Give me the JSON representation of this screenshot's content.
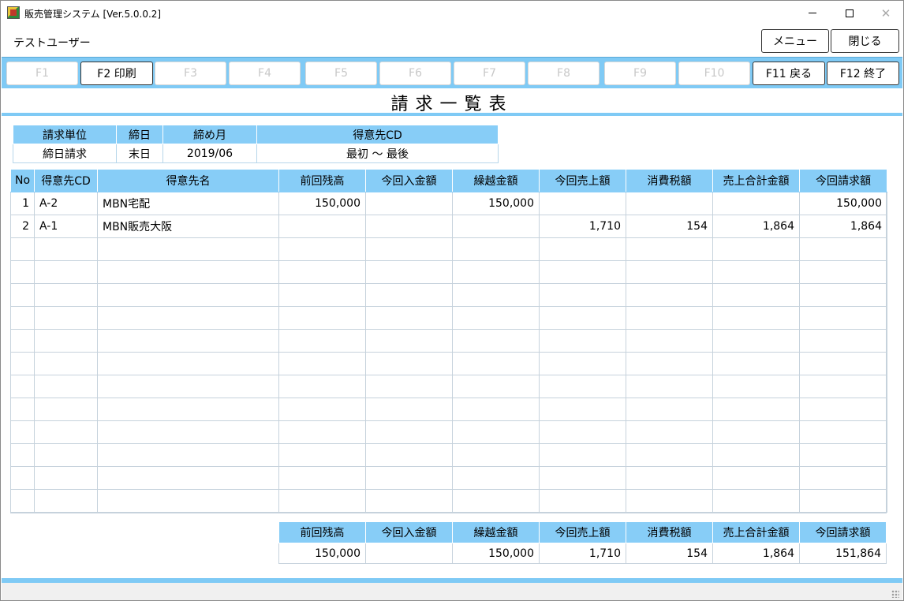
{
  "window": {
    "title": "販売管理システム [Ver.5.0.0.2]",
    "minimize": "",
    "maximize": "",
    "close": "✕"
  },
  "user": {
    "name": "テストユーザー"
  },
  "top_buttons": {
    "menu": "メニュー",
    "close": "閉じる"
  },
  "fkeys": [
    {
      "label": "F1",
      "enabled": false
    },
    {
      "label": "F2 印刷",
      "enabled": true
    },
    {
      "label": "F3",
      "enabled": false
    },
    {
      "label": "F4",
      "enabled": false
    },
    {
      "label": "F5",
      "enabled": false
    },
    {
      "label": "F6",
      "enabled": false
    },
    {
      "label": "F7",
      "enabled": false
    },
    {
      "label": "F8",
      "enabled": false
    },
    {
      "label": "F9",
      "enabled": false
    },
    {
      "label": "F10",
      "enabled": false
    },
    {
      "label": "F11 戻る",
      "enabled": true
    },
    {
      "label": "F12 終了",
      "enabled": true
    }
  ],
  "page": {
    "title": "請求一覧表"
  },
  "conditions": {
    "headers": [
      "請求単位",
      "締日",
      "締め月",
      "得意先CD"
    ],
    "values": [
      "締日請求",
      "末日",
      "2019/06",
      "最初 ～ 最後"
    ]
  },
  "main_table": {
    "headers": [
      "No",
      "得意先CD",
      "得意先名",
      "前回残高",
      "今回入金額",
      "繰越金額",
      "今回売上額",
      "消費税額",
      "売上合計金額",
      "今回請求額"
    ],
    "rows": [
      [
        "1",
        "A-2",
        "MBN宅配",
        "150,000",
        "",
        "150,000",
        "",
        "",
        "",
        "150,000"
      ],
      [
        "2",
        "A-1",
        "MBN販売大阪",
        "",
        "",
        "",
        "1,710",
        "154",
        "1,864",
        "1,864"
      ]
    ]
  },
  "totals": {
    "headers": [
      "前回残高",
      "今回入金額",
      "繰越金額",
      "今回売上額",
      "消費税額",
      "売上合計金額",
      "今回請求額"
    ],
    "values": [
      "150,000",
      "",
      "150,000",
      "1,710",
      "154",
      "1,864",
      "151,864"
    ]
  },
  "colors": {
    "accent": "#87cdf7",
    "bar": "#7fcaf5",
    "disabled_text": "#c8c8c8"
  }
}
